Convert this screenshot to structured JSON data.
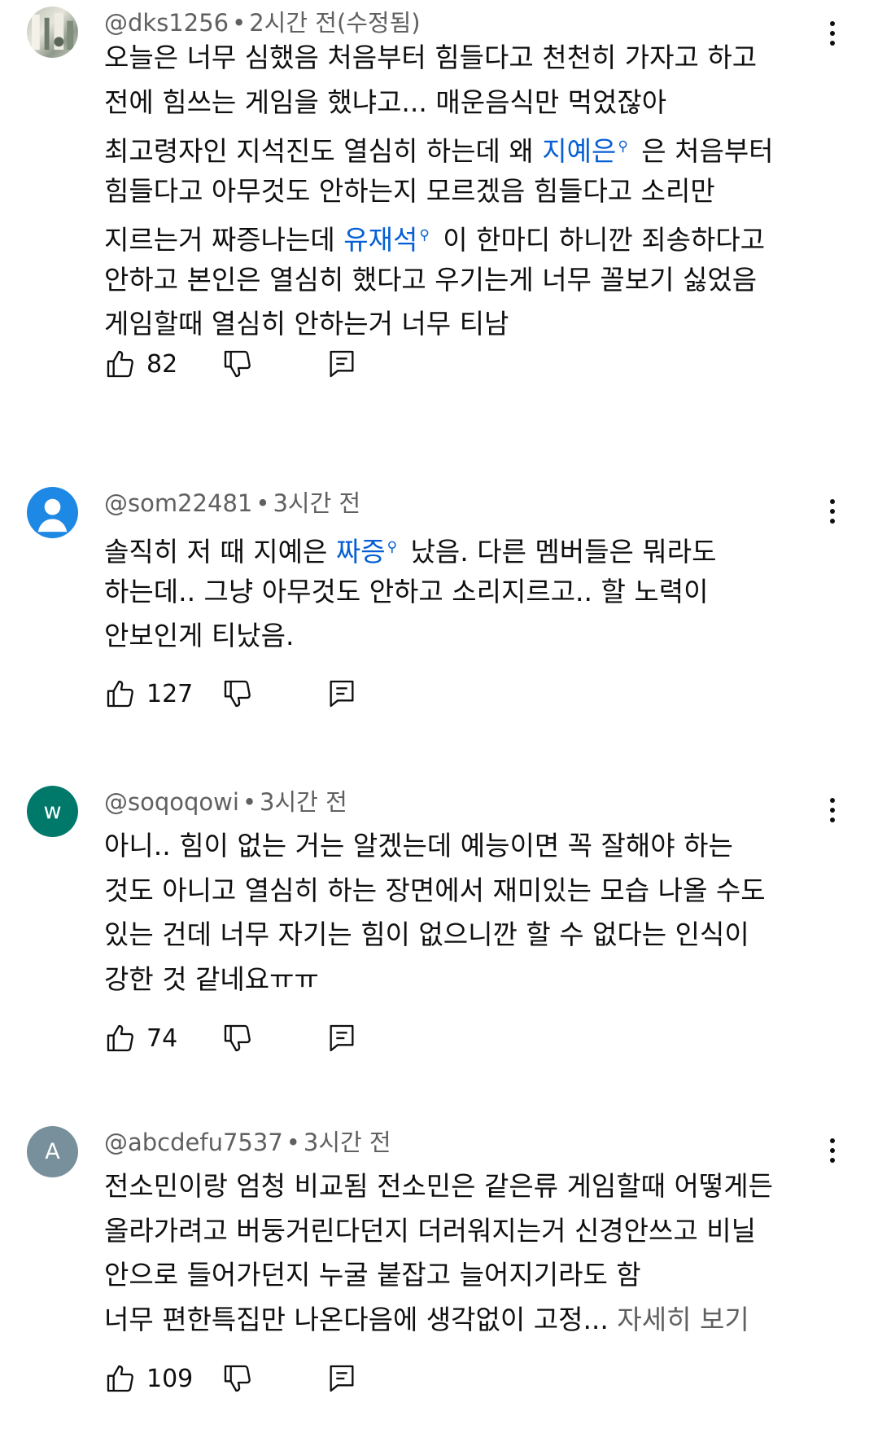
{
  "comments": [
    {
      "avatar": {
        "type": "photo",
        "letter": ""
      },
      "handle": "@dks1256",
      "time": "2시간 전(수정됨)",
      "lines": [
        [
          {
            "t": "오늘은 너무 심했음 처음부터 힘들다고 천천히 가자고 하고"
          }
        ],
        [
          {
            "t": "전에 힘쓰는 게임을 했냐고... 매운음식만 먹었잖아"
          }
        ],
        [
          {
            "t": "최고령자인 지석진도 열심히 하는데 왜 "
          },
          {
            "t": "지예은",
            "link": true
          },
          {
            "t": " 은 처음부터"
          }
        ],
        [
          {
            "t": "힘들다고 아무것도 안하는지 모르겠음 힘들다고 소리만"
          }
        ],
        [
          {
            "t": "지르는거 짜증나는데 "
          },
          {
            "t": "유재석",
            "link": true
          },
          {
            "t": " 이 한마디 하니깐 죄송하다고"
          }
        ],
        [
          {
            "t": "안하고 본인은 열심히 했다고 우기는게 너무 꼴보기 싫었음"
          }
        ],
        [
          {
            "t": "게임할때 열심히 안하는거 너무 티남"
          }
        ]
      ],
      "likes": "82"
    },
    {
      "avatar": {
        "type": "person",
        "letter": ""
      },
      "handle": "@som22481",
      "time": "3시간 전",
      "lines": [
        [
          {
            "t": "솔직히 저 때 지예은 "
          },
          {
            "t": "짜증",
            "link": true
          },
          {
            "t": " 났음. 다른 멤버들은 뭐라도"
          }
        ],
        [
          {
            "t": "하는데.. 그냥 아무것도 안하고 소리지르고.. 할 노력이"
          }
        ],
        [
          {
            "t": "안보인게 티났음."
          }
        ]
      ],
      "likes": "127"
    },
    {
      "avatar": {
        "type": "green",
        "letter": "w"
      },
      "handle": "@soqoqowi",
      "time": "3시간 전",
      "lines": [
        [
          {
            "t": "아니.. 힘이 없는 거는 알겠는데 예능이면 꼭 잘해야 하는"
          }
        ],
        [
          {
            "t": "것도 아니고 열심히 하는 장면에서 재미있는 모습 나올 수도"
          }
        ],
        [
          {
            "t": "있는 건데 너무 자기는 힘이 없으니깐 할 수 없다는 인식이"
          }
        ],
        [
          {
            "t": "강한 것 같네요ㅠㅠ"
          }
        ]
      ],
      "likes": "74"
    },
    {
      "avatar": {
        "type": "grey",
        "letter": "A"
      },
      "handle": "@abcdefu7537",
      "time": "3시간 전",
      "lines": [
        [
          {
            "t": "전소민이랑 엄청 비교됨 전소민은 같은류 게임할때 어떻게든"
          }
        ],
        [
          {
            "t": "올라가려고 버둥거린다던지 더러워지는거 신경안쓰고 비닐"
          }
        ],
        [
          {
            "t": "안으로 들어가던지 누굴 붙잡고 늘어지기라도 함"
          }
        ],
        [
          {
            "t": "너무 편한특집만 나온다음에 생각없이 고정... "
          },
          {
            "t": "자세히 보기",
            "more": true
          }
        ]
      ],
      "likes": "109"
    }
  ],
  "meta_separator": "•",
  "icons": {
    "like": "thumbs-up-icon",
    "dislike": "thumbs-down-icon",
    "reply": "reply-icon",
    "more": "more-vert-icon",
    "search": "search-icon"
  },
  "colors": {
    "link": "#065fd4",
    "meta": "#606060",
    "text": "#0f0f0f"
  }
}
